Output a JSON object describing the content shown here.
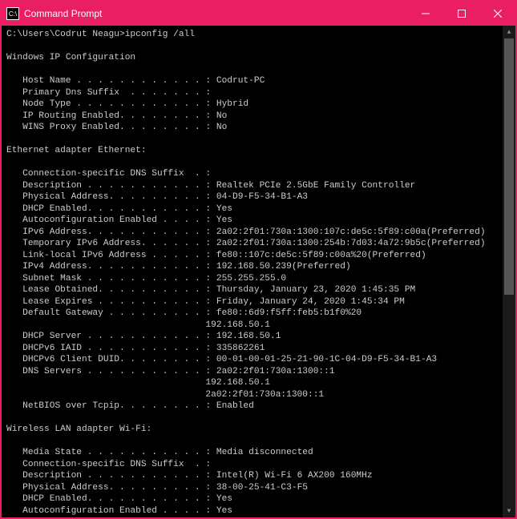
{
  "window": {
    "title": "Command Prompt",
    "icon_label": "cmd-icon"
  },
  "prompt": {
    "path": "C:\\Users\\Codrut Neagu>",
    "command": "ipconfig /all"
  },
  "sections": {
    "global": {
      "header": "Windows IP Configuration",
      "fields": {
        "host_name": {
          "label": "Host Name . . . . . . . . . . . . :",
          "value": "Codrut-PC"
        },
        "primary_dns_suffix": {
          "label": "Primary Dns Suffix  . . . . . . . :",
          "value": ""
        },
        "node_type": {
          "label": "Node Type . . . . . . . . . . . . :",
          "value": "Hybrid"
        },
        "ip_routing": {
          "label": "IP Routing Enabled. . . . . . . . :",
          "value": "No"
        },
        "wins_proxy": {
          "label": "WINS Proxy Enabled. . . . . . . . :",
          "value": "No"
        }
      }
    },
    "ethernet": {
      "header": "Ethernet adapter Ethernet:",
      "fields": {
        "conn_dns_suffix": {
          "label": "Connection-specific DNS Suffix  . :",
          "value": ""
        },
        "description": {
          "label": "Description . . . . . . . . . . . :",
          "value": "Realtek PCIe 2.5GbE Family Controller"
        },
        "physical_address": {
          "label": "Physical Address. . . . . . . . . :",
          "value": "04-D9-F5-34-B1-A3"
        },
        "dhcp_enabled": {
          "label": "DHCP Enabled. . . . . . . . . . . :",
          "value": "Yes"
        },
        "autoconf_enabled": {
          "label": "Autoconfiguration Enabled . . . . :",
          "value": "Yes"
        },
        "ipv6_address": {
          "label": "IPv6 Address. . . . . . . . . . . :",
          "value": "2a02:2f01:730a:1300:107c:de5c:5f89:c00a(Preferred)"
        },
        "temp_ipv6": {
          "label": "Temporary IPv6 Address. . . . . . :",
          "value": "2a02:2f01:730a:1300:254b:7d03:4a72:9b5c(Preferred)"
        },
        "link_local_ipv6": {
          "label": "Link-local IPv6 Address . . . . . :",
          "value": "fe80::107c:de5c:5f89:c00a%20(Preferred)"
        },
        "ipv4_address": {
          "label": "IPv4 Address. . . . . . . . . . . :",
          "value": "192.168.50.239(Preferred)"
        },
        "subnet_mask": {
          "label": "Subnet Mask . . . . . . . . . . . :",
          "value": "255.255.255.0"
        },
        "lease_obtained": {
          "label": "Lease Obtained. . . . . . . . . . :",
          "value": "Thursday, January 23, 2020 1:45:35 PM"
        },
        "lease_expires": {
          "label": "Lease Expires . . . . . . . . . . :",
          "value": "Friday, January 24, 2020 1:45:34 PM"
        },
        "default_gateway": {
          "label": "Default Gateway . . . . . . . . . :",
          "value": "fe80::6d9:f5ff:feb5:b1f0%20",
          "cont_pad": "                                    ",
          "value2": "192.168.50.1"
        },
        "dhcp_server": {
          "label": "DHCP Server . . . . . . . . . . . :",
          "value": "192.168.50.1"
        },
        "dhcpv6_iaid": {
          "label": "DHCPv6 IAID . . . . . . . . . . . :",
          "value": "335862261"
        },
        "dhcpv6_client_duid": {
          "label": "DHCPv6 Client DUID. . . . . . . . :",
          "value": "00-01-00-01-25-21-90-1C-04-D9-F5-34-B1-A3"
        },
        "dns_servers": {
          "label": "DNS Servers . . . . . . . . . . . :",
          "value": "2a02:2f01:730a:1300::1",
          "cont_pad": "                                    ",
          "value2": "192.168.50.1",
          "value3": "2a02:2f01:730a:1300::1"
        },
        "netbios": {
          "label": "NetBIOS over Tcpip. . . . . . . . :",
          "value": "Enabled"
        }
      }
    },
    "wifi": {
      "header": "Wireless LAN adapter Wi-Fi:",
      "fields": {
        "media_state": {
          "label": "Media State . . . . . . . . . . . :",
          "value": "Media disconnected"
        },
        "conn_dns_suffix": {
          "label": "Connection-specific DNS Suffix  . :",
          "value": ""
        },
        "description": {
          "label": "Description . . . . . . . . . . . :",
          "value": "Intel(R) Wi-Fi 6 AX200 160MHz"
        },
        "physical_address": {
          "label": "Physical Address. . . . . . . . . :",
          "value": "38-00-25-41-C3-F5"
        },
        "dhcp_enabled": {
          "label": "DHCP Enabled. . . . . . . . . . . :",
          "value": "Yes"
        },
        "autoconf_enabled": {
          "label": "Autoconfiguration Enabled . . . . :",
          "value": "Yes"
        }
      }
    }
  },
  "indent": "   "
}
